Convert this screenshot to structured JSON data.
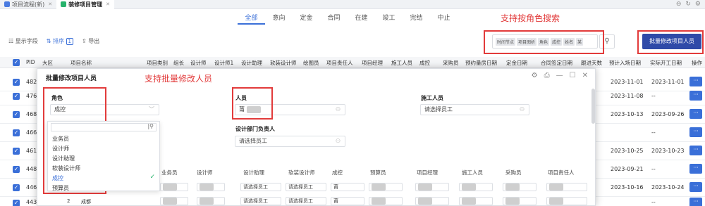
{
  "top_tabs": [
    {
      "label": "项目流程(新)"
    },
    {
      "label": "装修项目管理"
    }
  ],
  "status_tabs": [
    "全部",
    "意向",
    "定金",
    "合同",
    "在建",
    "竣工",
    "完结",
    "中止"
  ],
  "notes": {
    "role_search": "支持按角色搜索",
    "bulk_modify": "支持批量修改人员"
  },
  "toolbar": {
    "show_fields": "显示字段",
    "sort": "排序",
    "sort_count": "1",
    "export": "导出"
  },
  "search": {
    "chips": [
      "时间节点",
      "项目图析",
      "角色",
      "成控",
      "姓名",
      "某"
    ]
  },
  "bulk_button": "批量修改项目人员",
  "table": {
    "headers": [
      "PID",
      "大区",
      "项目名称",
      "项目类别",
      "组长",
      "设计师",
      "设计师1",
      "设计助理",
      "软装设计师",
      "绘图员",
      "项目责任人",
      "项目经理",
      "施工人员",
      "成控",
      "采购员",
      "预约量房日期",
      "定金日期",
      "合同签定日期",
      "跟进天数",
      "预计入场日期",
      "实际开工日期",
      "操作"
    ],
    "rows": [
      {
        "pid": "482",
        "d1": "2023-11-01",
        "d2": "2023-11-01"
      },
      {
        "pid": "476",
        "d1": "2023-11-08",
        "d2": "--"
      },
      {
        "pid": "468",
        "d1": "2023-10-13",
        "d2": "2023-09-26"
      },
      {
        "pid": "466",
        "d1": "",
        "d2": "--"
      },
      {
        "pid": "461",
        "d1": "2023-10-25",
        "d2": "2023-10-23"
      },
      {
        "pid": "448",
        "d1": "2023-09-21",
        "d2": "--"
      },
      {
        "pid": "446",
        "d1": "2023-10-16",
        "d2": "2023-10-24"
      },
      {
        "pid": "443",
        "d1": "",
        "d2": "--"
      }
    ],
    "op_label": "···"
  },
  "modal": {
    "title": "批量修改项目人员",
    "role_label": "角色",
    "role_value": "成控",
    "person_label": "人员",
    "person_value": "莆",
    "builder_label": "施工人员",
    "builder_placeholder": "请选择员工",
    "dept_head_label": "设计部门负责人",
    "dept_head_placeholder": "请选择员工",
    "dropdown_options": [
      "业务员",
      "设计师",
      "设计助理",
      "软装设计师",
      "成控",
      "预算员"
    ],
    "dropdown_selected": "成控",
    "grid_headers": [
      "业务员",
      "设计师",
      "设计助理",
      "软装设计师",
      "成控",
      "预算员",
      "项目经理",
      "施工人员",
      "采购员",
      "项目责任人"
    ],
    "grid_rows": [
      {
        "c1": "请选择员工",
        "c2": "请选择员工",
        "c3": "莆"
      },
      {
        "c1": "请选择员工",
        "c2": "请选择员工",
        "c3": "莆"
      }
    ],
    "row_number": "2",
    "row_name": "成都"
  },
  "colors": {
    "accent": "#3a6fd8",
    "bulk_button": "#2f4aa8",
    "annotation": "#e23b3b"
  }
}
